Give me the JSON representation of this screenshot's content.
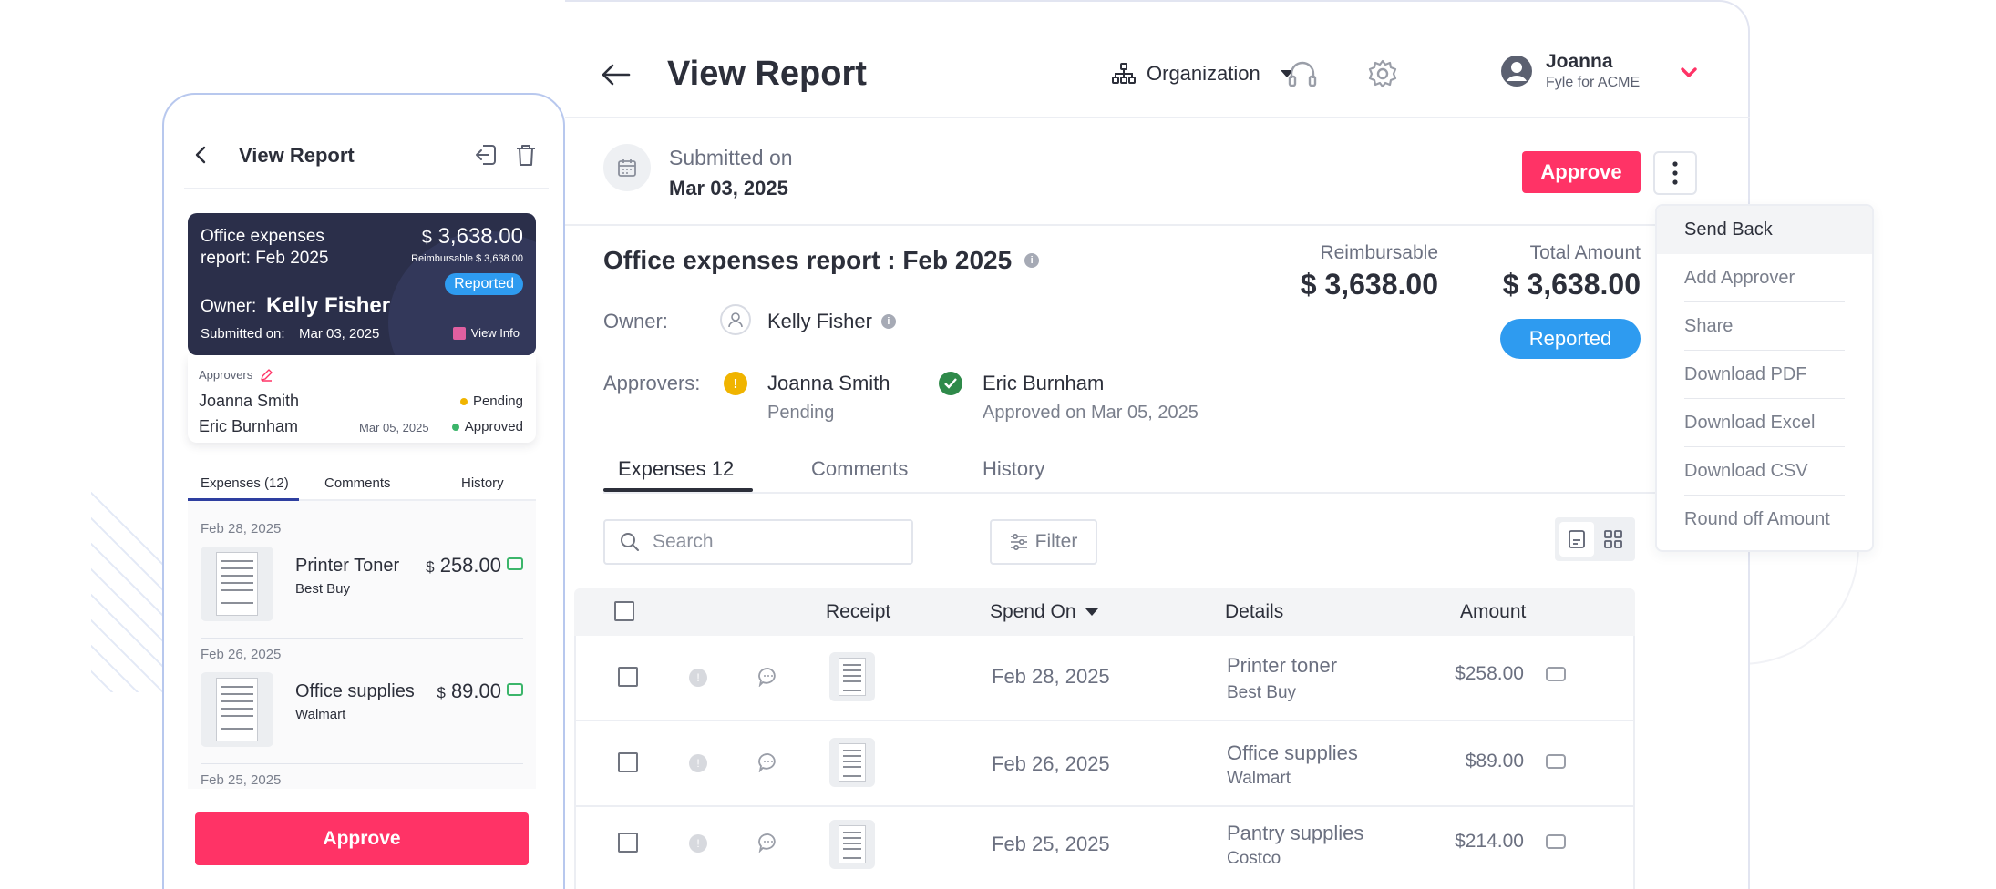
{
  "desktop": {
    "title": "View Report",
    "org_label": "Organization",
    "user": {
      "name": "Joanna",
      "org": "Fyle for ACME"
    },
    "submitted_label": "Submitted on",
    "submitted_date": "Mar 03, 2025",
    "approve_label": "Approve",
    "report_title": "Office expenses report : Feb 2025",
    "owner_label": "Owner:",
    "owner_name": "Kelly Fisher",
    "approvers_label": "Approvers:",
    "approvers": [
      {
        "name": "Joanna Smith",
        "status": "Pending",
        "status_color": "#f0b400"
      },
      {
        "name": "Eric Burnham",
        "status": "Approved on Mar 05, 2025",
        "status_color": "#2f8a4a"
      }
    ],
    "reimbursable_label": "Reimbursable",
    "reimbursable_value": "$ 3,638.00",
    "total_label": "Total Amount",
    "total_value": "$ 3,638.00",
    "status_pill": "Reported",
    "tabs": [
      {
        "label": "Expenses 12"
      },
      {
        "label": "Comments"
      },
      {
        "label": "History"
      }
    ],
    "search_placeholder": "Search",
    "filter_label": "Filter",
    "table": {
      "headers": {
        "receipt": "Receipt",
        "spend_on": "Spend On",
        "details": "Details",
        "amount": "Amount"
      },
      "rows": [
        {
          "date": "Feb 28, 2025",
          "name": "Printer toner",
          "vendor": "Best Buy",
          "amount": "$258.00"
        },
        {
          "date": "Feb 26, 2025",
          "name": "Office supplies",
          "vendor": "Walmart",
          "amount": "$89.00"
        },
        {
          "date": "Feb 25, 2025",
          "name": "Pantry supplies",
          "vendor": "Costco",
          "amount": "$214.00"
        }
      ]
    },
    "menu": [
      "Send Back",
      "Add Approver",
      "Share",
      "Download PDF",
      "Download Excel",
      "Download CSV",
      "Round off Amount"
    ]
  },
  "mobile": {
    "title": "View Report",
    "card": {
      "title": "Office expenses report: Feb 2025",
      "currency": "$",
      "amount": "3,638.00",
      "reimbursable": "Reimbursable $ 3,638.00",
      "status": "Reported",
      "owner_label": "Owner:",
      "owner_name": "Kelly Fisher",
      "submitted_label": "Submitted on:",
      "submitted_date": "Mar 03, 2025",
      "view_info": "View Info"
    },
    "approvers_label": "Approvers",
    "approvers": [
      {
        "name": "Joanna Smith",
        "date": "",
        "status": "Pending",
        "status_color": "#f0b400"
      },
      {
        "name": "Eric Burnham",
        "date": "Mar 05, 2025",
        "status": "Approved",
        "status_color": "#3bb56a"
      }
    ],
    "tabs": [
      "Expenses (12)",
      "Comments",
      "History"
    ],
    "expenses": [
      {
        "date": "Feb 28, 2025",
        "name": "Printer Toner",
        "vendor": "Best Buy",
        "currency": "$",
        "amount": "258.00"
      },
      {
        "date": "Feb 26, 2025",
        "name": "Office supplies",
        "vendor": "Walmart",
        "currency": "$",
        "amount": "89.00"
      },
      {
        "date": "Feb 25, 2025"
      }
    ],
    "approve_label": "Approve"
  },
  "colors": {
    "primary": "#ff3366",
    "reported": "#2e9bf0",
    "card_bg": "#2b2f4a"
  },
  "icons": [
    "back-arrow-icon",
    "org-chart-icon",
    "headset-icon",
    "gear-icon",
    "user-avatar-icon",
    "chevron-down-icon",
    "calendar-icon",
    "info-icon",
    "search-icon",
    "filter-icon",
    "list-view-icon",
    "grid-view-icon",
    "comment-icon",
    "card-icon",
    "export-icon",
    "trash-icon",
    "edit-icon"
  ]
}
